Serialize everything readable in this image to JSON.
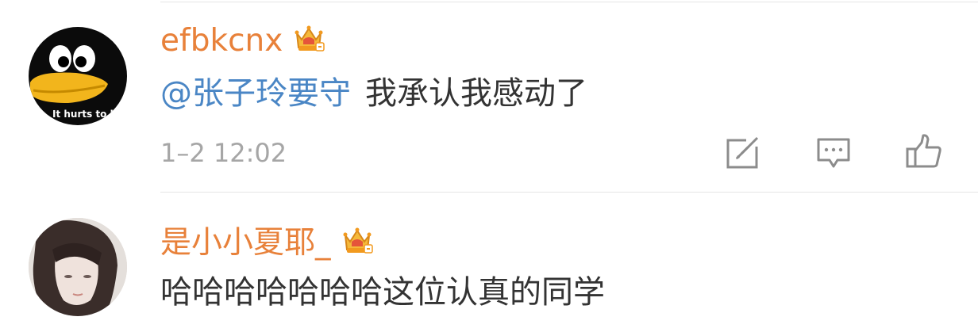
{
  "comments": [
    {
      "username": "efbkcnx",
      "mention": "@张子玲要守",
      "text": "我承认我感动了",
      "timestamp": "1–2 12:02",
      "avatar_caption": "It hurts to li",
      "icons": {
        "badge": "crown-badge-icon",
        "edit": "edit-icon",
        "reply": "comment-icon",
        "like": "thumbs-up-icon"
      }
    },
    {
      "username": "是小小夏耶_",
      "text": "哈哈哈哈哈哈哈这位认真的同学",
      "icons": {
        "badge": "crown-badge-icon"
      }
    }
  ],
  "colors": {
    "username": "#e8813a",
    "mention": "#4a86c5",
    "text": "#333333",
    "meta": "#a6a6a6",
    "icon": "#8c8c8c",
    "divider": "#e6e6e6"
  }
}
